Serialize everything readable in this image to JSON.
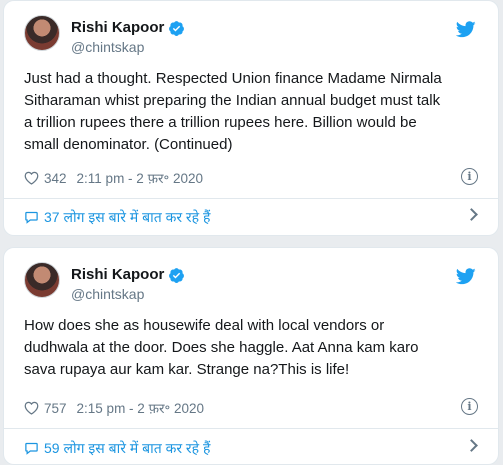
{
  "tweets": [
    {
      "author_name": "Rishi Kapoor",
      "author_handle": "@chintskap",
      "text": "Just had a thought. Respected Union finance Madame Nirmala\nSitharaman whist preparing the Indian annual budget must talk\na trillion rupees there a trillion rupees here. Billion would be\nsmall denominator. (Continued)",
      "likes": "342",
      "timestamp": "2:11 pm - 2 फ़र॰ 2020",
      "discussion": "37 लोग इस बारे में बात कर रहे हैं"
    },
    {
      "author_name": "Rishi Kapoor",
      "author_handle": "@chintskap",
      "text": "How does she as housewife deal with local vendors  or\ndudhwala at the door. Does she haggle. Aat Anna kam karo\nsava rupaya aur kam kar. Strange na?This is life!",
      "likes": "757",
      "timestamp": "2:15 pm - 2 फ़र॰ 2020",
      "discussion": "59 लोग इस बारे में बात कर रहे हैं"
    }
  ],
  "colors": {
    "accent": "#1da1f2",
    "link": "#1b95e0",
    "muted": "#657786",
    "text": "#14171a"
  },
  "icons": [
    "verified-badge-icon",
    "twitter-bird-icon",
    "heart-icon",
    "info-icon",
    "chat-bubble-icon",
    "chevron-right-icon"
  ]
}
